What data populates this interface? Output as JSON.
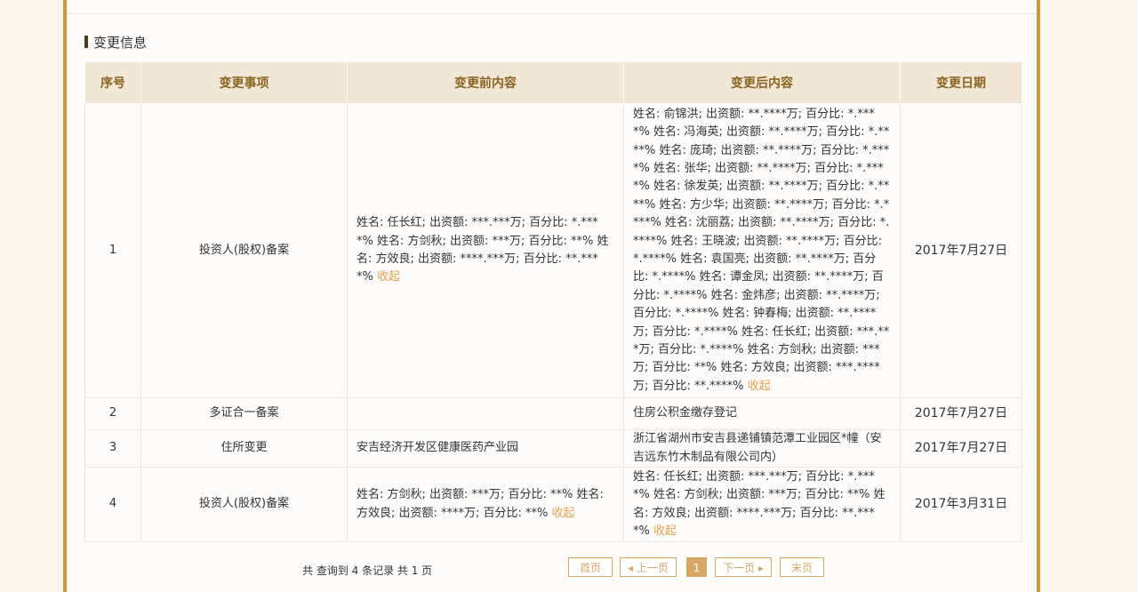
{
  "section": {
    "title": "变更信息"
  },
  "table": {
    "headers": [
      "序号",
      "变更事项",
      "变更前内容",
      "变更后内容",
      "变更日期"
    ],
    "fold_label": "收起",
    "rows": [
      {
        "no": "1",
        "item": "投资人(股权)备案",
        "before": "姓名: 任长红; 出资额: ***.***万; 百分比: *.****% 姓名: 方剑秋; 出资额: ***万; 百分比: **% 姓名: 方效良; 出资额: ****.***万; 百分比: **.****% ",
        "after": "姓名: 俞锦洪; 出资额: **.****万; 百分比: *.****% 姓名: 冯海英; 出资额: **.****万; 百分比: *.****% 姓名: 庞琦; 出资额: **.****万; 百分比: *.****% 姓名: 张华; 出资额: **.****万; 百分比: *.****% 姓名: 徐发英; 出资额: **.****万; 百分比: *.****% 姓名: 方少华; 出资额: **.****万; 百分比: *.****% 姓名: 沈丽荔; 出资额: **.****万; 百分比: *.****% 姓名: 王晓波; 出资额: **.****万; 百分比: *.****% 姓名: 袁国亮; 出资额: **.****万; 百分比: *.****% 姓名: 谭金凤; 出资额: **.****万; 百分比: *.****% 姓名: 金炜彦; 出资额: **.****万; 百分比: *.****% 姓名: 钟春梅; 出资额: **.****万; 百分比: *.****% 姓名: 任长红; 出资额: ***.***万; 百分比: *.****% 姓名: 方剑秋; 出资额: ***万; 百分比: **% 姓名: 方效良; 出资额: ***.****万; 百分比: **.****% ",
        "date": "2017年7月27日"
      },
      {
        "no": "2",
        "item": "多证合一备案",
        "before": "",
        "after": "住房公积金缴存登记",
        "date": "2017年7月27日"
      },
      {
        "no": "3",
        "item": "住所变更",
        "before": "安吉经济开发区健康医药产业园",
        "after": "浙江省湖州市安吉县递铺镇范潭工业园区*幢（安吉远东竹木制品有限公司内）",
        "date": "2017年7月27日"
      },
      {
        "no": "4",
        "item": "投资人(股权)备案",
        "before": "姓名: 方剑秋; 出资额: ***万; 百分比: **% 姓名: 方效良; 出资额: ****万; 百分比: **% ",
        "after": "姓名: 任长红; 出资额: ***.***万; 百分比: *.****% 姓名: 方剑秋; 出资额: ***万; 百分比: **% 姓名: 方效良; 出资额: ****.***万; 百分比: **.****% ",
        "date": "2017年3月31日"
      }
    ]
  },
  "pager": {
    "summary": "共 查询到 4 条记录 共 1 页",
    "first": "首页",
    "prev": "◂ 上一页",
    "current": "1",
    "next": "下一页 ▸",
    "last": "末页"
  }
}
